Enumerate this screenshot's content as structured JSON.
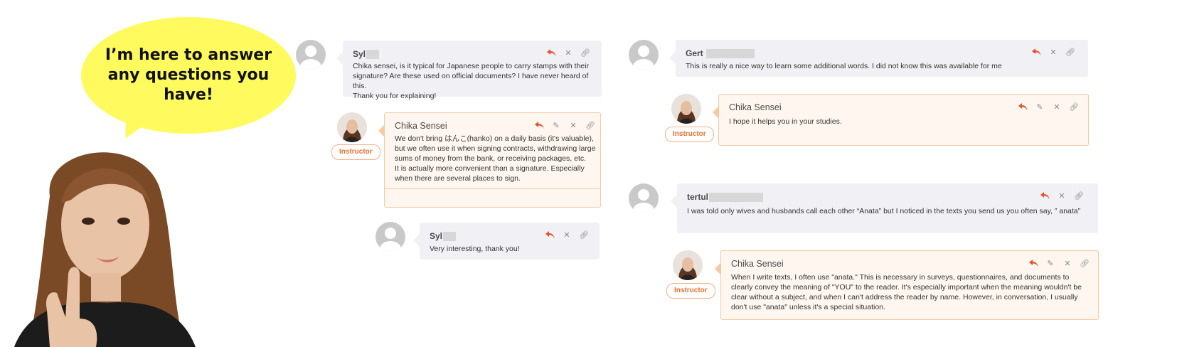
{
  "promo": {
    "bubble_text": "I’m here to answer any questions you have!"
  },
  "thread_left": {
    "comment_1": {
      "author": "Syl",
      "text": "Chika sensei, is it typical for Japanese people to carry stamps with their\nsignature? Are these used on official documents? I have never heard of this.\nThank you for explaining!"
    },
    "reply_1": {
      "author": "Chika Sensei",
      "badge": "Instructor",
      "text": "We don't bring はんこ(hanko) on a daily basis (it's valuable),\nbut we often use it when signing contracts, withdrawing large\nsums of money from the bank, or receiving packages, etc.\nIt is actually more convenient than a signature. Especially\nwhen there are several places to sign."
    },
    "comment_2": {
      "author": "Syl",
      "text": "Very interesting, thank you!"
    }
  },
  "thread_right": {
    "comment_1": {
      "author": "Gert",
      "text": "This is really a nice way to learn some additional words. I did not know this was available for me"
    },
    "reply_1": {
      "author": "Chika Sensei",
      "badge": "Instructor",
      "text": "I hope it helps you in your studies."
    },
    "comment_2": {
      "author": "tertul",
      "text": "I was told only wives and husbands call each other “Anata” but I noticed in the texts you send us you often say, ” anata”"
    },
    "reply_2": {
      "author": "Chika Sensei",
      "badge": "Instructor",
      "text": "When I write texts, I often use \"anata.\" This is necessary in surveys, questionnaires, and documents to\nclearly convey the meaning of \"YOU\" to the reader. It's especially important when the meaning wouldn't be\nclear without a subject, and when I can't address the reader by name. However, in conversation, I usually\ndon't use \"anata\" unless it's a special situation."
    }
  },
  "icons": [
    "reply-icon",
    "edit-icon",
    "delete-icon",
    "link-icon",
    "user-avatar-icon"
  ],
  "colors": {
    "accent": "#e8502e",
    "bubble": "#fffb5e",
    "user_card": "#f1f1f5",
    "instructor_card": "#fff7ef",
    "instructor_border": "#f6c9a2"
  }
}
